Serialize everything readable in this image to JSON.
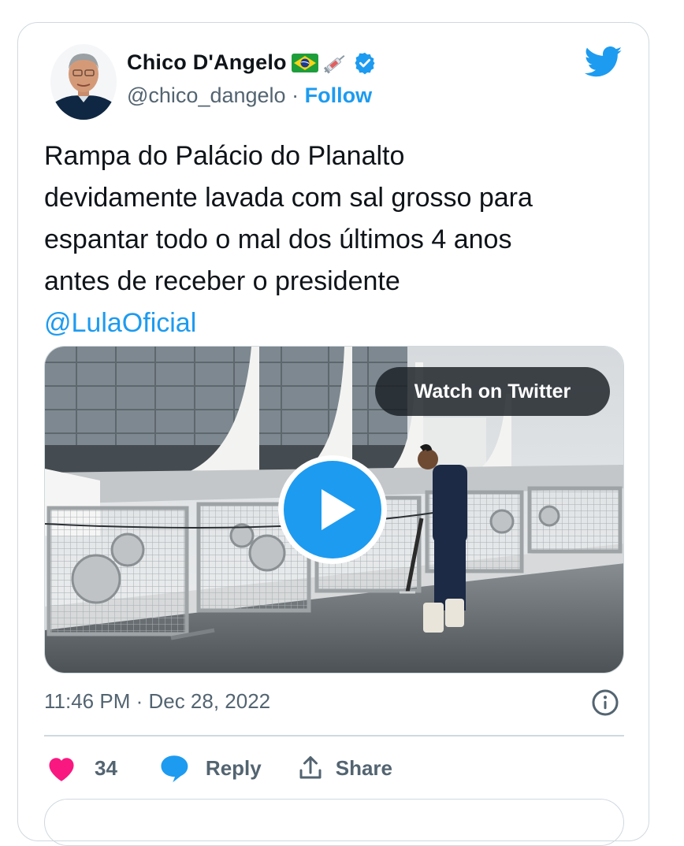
{
  "tweet": {
    "author_name": "Chico D'Angelo",
    "name_emoji": "🇧🇷💉",
    "handle": "@chico_dangelo",
    "separator": "·",
    "follow_label": "Follow",
    "text": "Rampa do Palácio do Planalto\ndevidamente lavada com sal grosso para\nespantar todo o mal dos últimos 4 anos\nantes de receber o presidente",
    "mention": "@LulaOficial",
    "timestamp": "11:46 PM · Dec 28, 2022"
  },
  "media": {
    "watch_label": "Watch on Twitter"
  },
  "actions": {
    "like_count": "34",
    "reply_label": "Reply",
    "share_label": "Share"
  },
  "icons": {
    "brand": "twitter-bird-icon",
    "verified": "verified-badge-icon",
    "play": "play-icon",
    "info": "info-icon",
    "like": "heart-icon",
    "reply": "speech-bubble-icon",
    "share": "share-icon"
  },
  "colors": {
    "accent": "#1d9bf0",
    "like": "#f91880",
    "text": "#0f1419",
    "muted": "#536471",
    "border": "#cfd9de"
  }
}
